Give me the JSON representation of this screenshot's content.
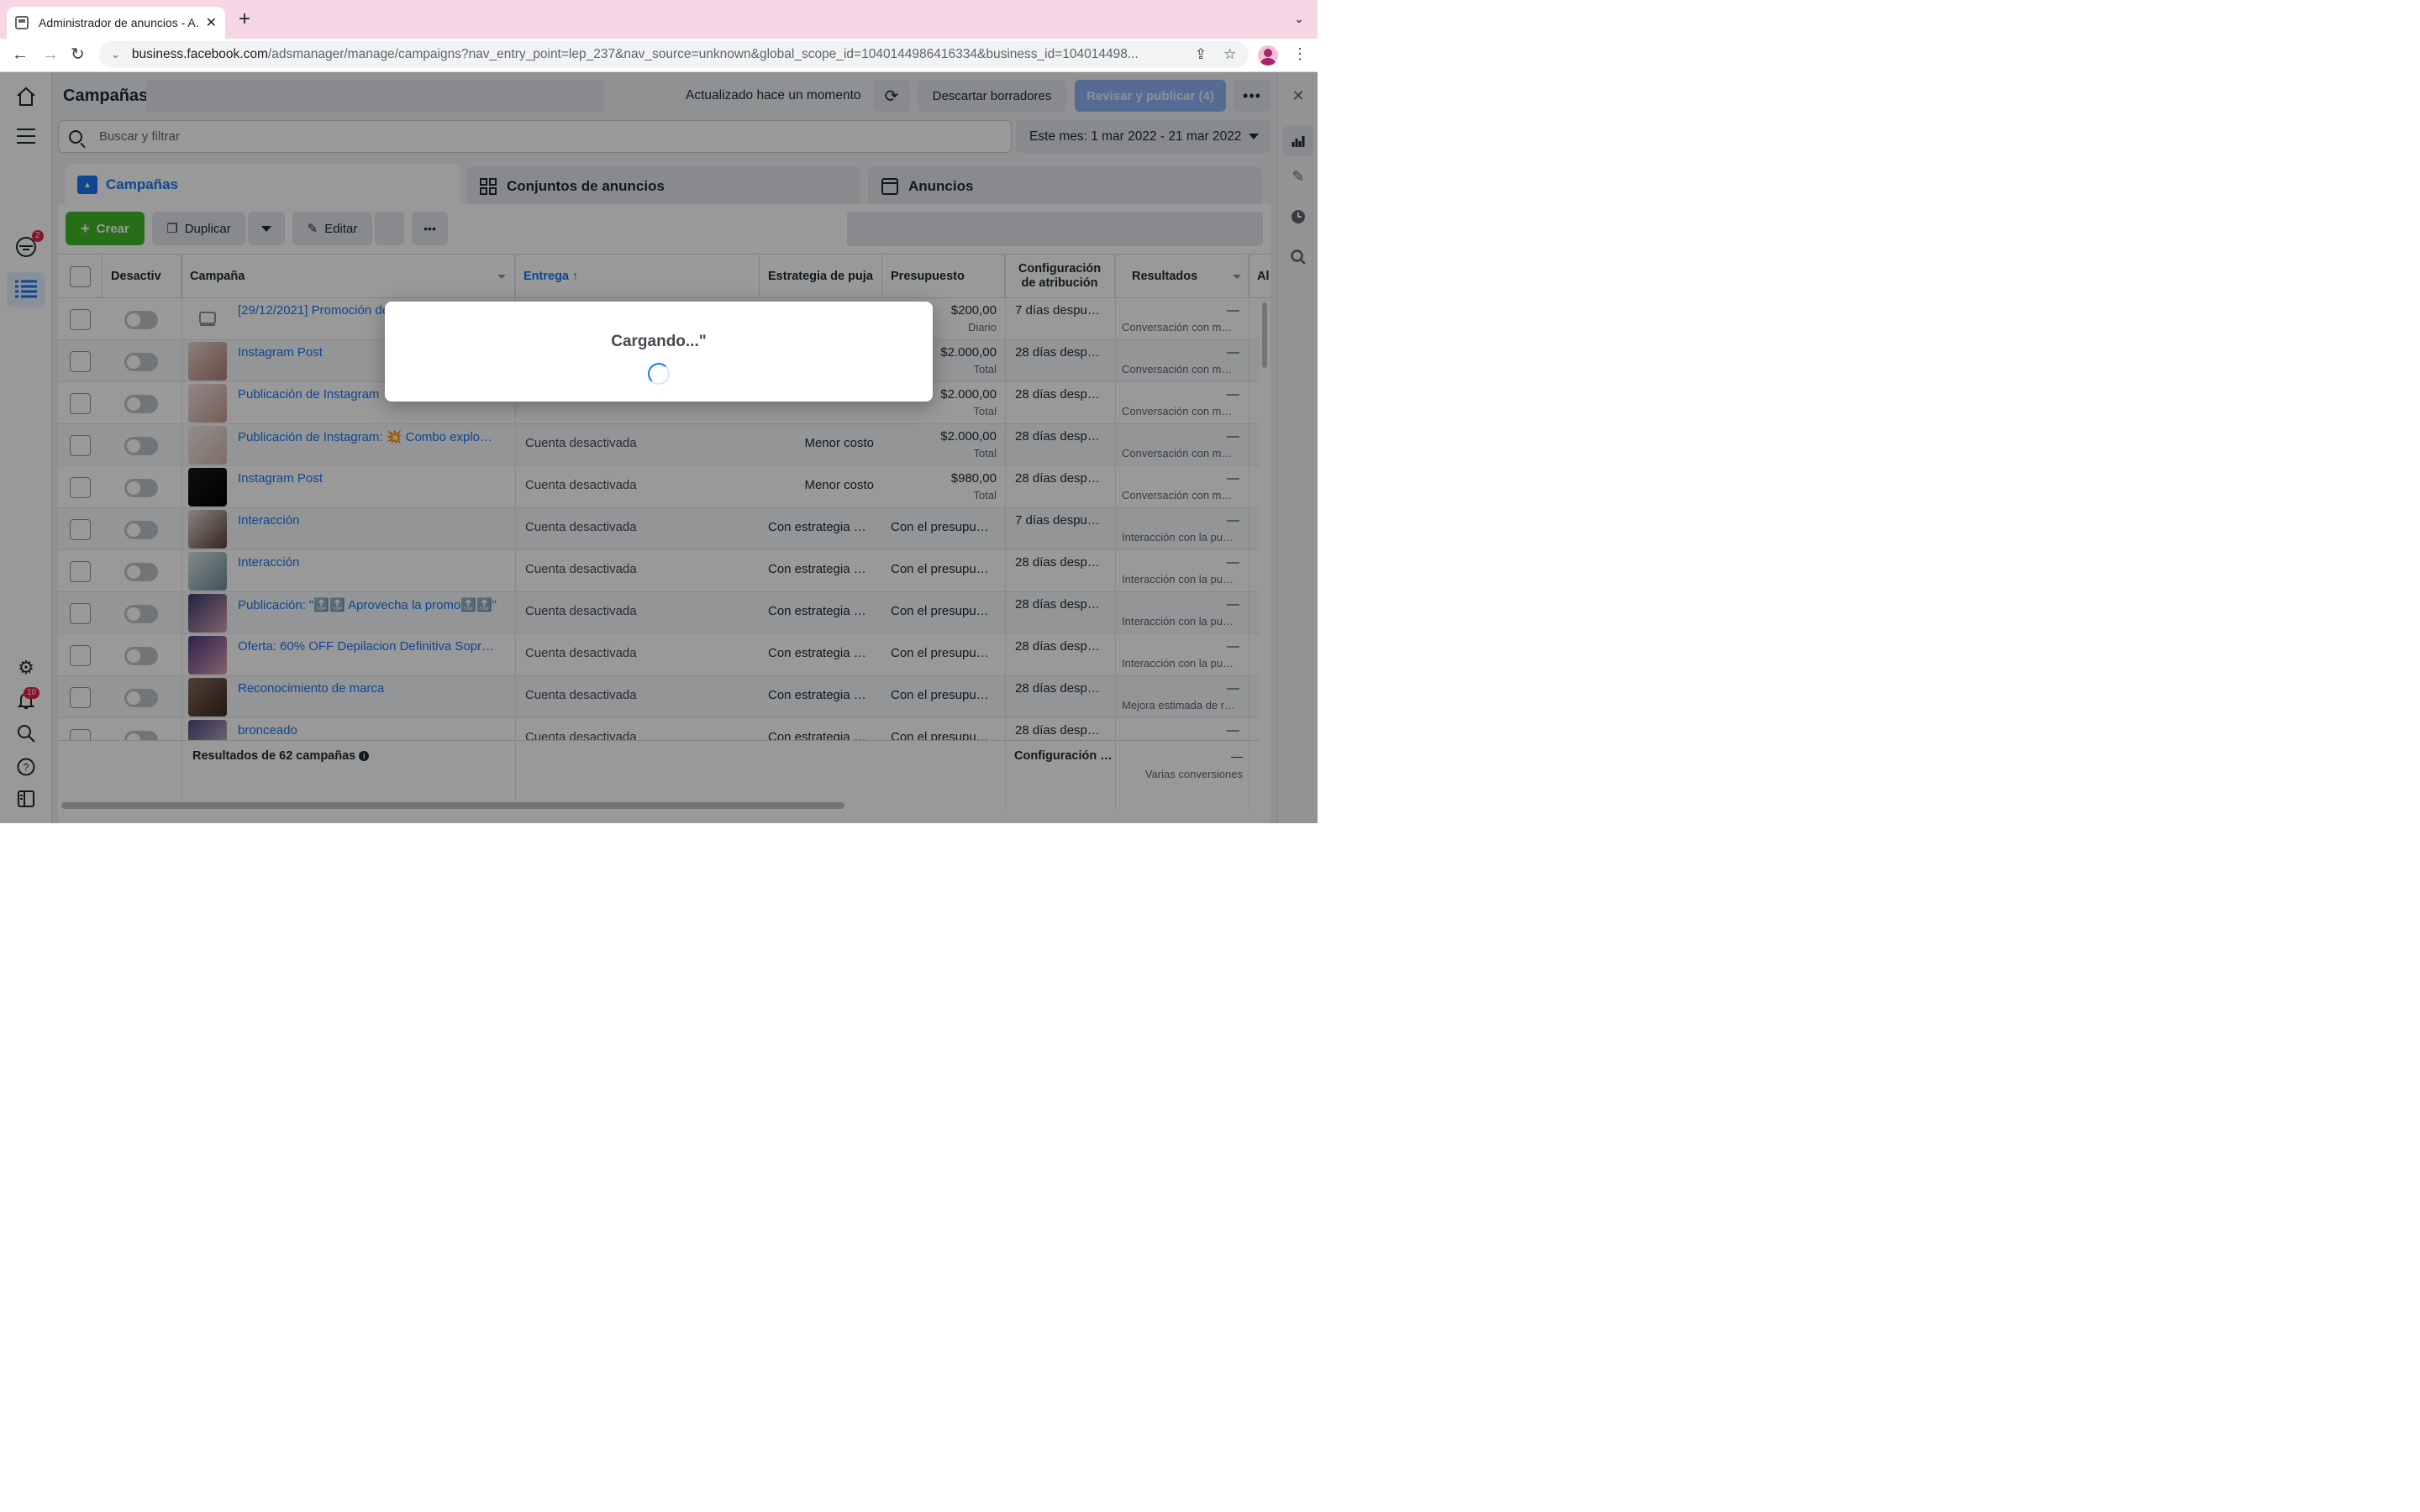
{
  "browser": {
    "tab_title": "Administrador de anuncios - A…",
    "new_tab": "+",
    "url_main": "business.facebook.com",
    "url_rest": "/adsmanager/manage/campaigns?nav_entry_point=lep_237&nav_source=unknown&global_scope_id=1040144986416334&business_id=104014498..."
  },
  "left_nav": {
    "campaigns_badge": "2",
    "notifications_badge": "10"
  },
  "header": {
    "title": "Campañas",
    "updated": "Actualizado hace un momento",
    "discard_label": "Descartar borradores",
    "publish_label": "Revisar y publicar (4)",
    "search_placeholder": "Buscar y filtrar",
    "date_range": "Este mes: 1 mar 2022 - 21 mar 2022"
  },
  "level_tabs": [
    {
      "label": "Campañas"
    },
    {
      "label": "Conjuntos de anuncios"
    },
    {
      "label": "Anuncios"
    }
  ],
  "toolbar": {
    "create": "Crear",
    "duplicate": "Duplicar",
    "edit": "Editar"
  },
  "columns": {
    "toggle": "Desactiv",
    "campaign": "Campaña",
    "delivery": "Entrega",
    "bid": "Estrategia de puja",
    "budget": "Presupuesto",
    "attribution_1": "Configuración",
    "attribution_2": "de atribución",
    "results": "Resultados",
    "next": "Al"
  },
  "rows": [
    {
      "name": "[29/12/2021] Promoción de",
      "delivery": "",
      "bid": "",
      "budget": "$200,00",
      "budget_sub": "Diario",
      "attribution": "7 días despu…",
      "result": "—",
      "result_sub": "Conversación con m…"
    },
    {
      "name": "Instagram Post",
      "delivery": "",
      "bid": "",
      "budget": "$2.000,00",
      "budget_sub": "Total",
      "attribution": "28 días desp…",
      "result": "—",
      "result_sub": "Conversación con m…"
    },
    {
      "name": "Publicación de Instagram",
      "delivery": "",
      "bid": "",
      "budget": "$2.000,00",
      "budget_sub": "Total",
      "attribution": "28 días desp…",
      "result": "—",
      "result_sub": "Conversación con m…"
    },
    {
      "name": "Publicación de Instagram: 💥 Combo explosi…",
      "delivery": "Cuenta desactivada",
      "bid": "Menor costo",
      "budget": "$2.000,00",
      "budget_sub": "Total",
      "attribution": "28 días desp…",
      "result": "—",
      "result_sub": "Conversación con m…"
    },
    {
      "name": "Instagram Post",
      "delivery": "Cuenta desactivada",
      "bid": "Menor costo",
      "budget": "$980,00",
      "budget_sub": "Total",
      "attribution": "28 días desp…",
      "result": "—",
      "result_sub": "Conversación con m…"
    },
    {
      "name": "Interacción",
      "delivery": "Cuenta desactivada",
      "bid": "Con estrategia …",
      "budget": "Con el presupu…",
      "budget_sub": "",
      "attribution": "7 días despu…",
      "result": "—",
      "result_sub": "Interacción con la pu…"
    },
    {
      "name": "Interacción",
      "delivery": "Cuenta desactivada",
      "bid": "Con estrategia …",
      "budget": "Con el presupu…",
      "budget_sub": "",
      "attribution": "28 días desp…",
      "result": "—",
      "result_sub": "Interacción con la pu…"
    },
    {
      "name": "Publicación: \"🔝🔝 Aprovecha la promo🔝🔝\"",
      "delivery": "Cuenta desactivada",
      "bid": "Con estrategia …",
      "budget": "Con el presupu…",
      "budget_sub": "",
      "attribution": "28 días desp…",
      "result": "—",
      "result_sub": "Interacción con la pu…"
    },
    {
      "name": "Oferta: 60% OFF Depilacion Definitiva Sopra…",
      "delivery": "Cuenta desactivada",
      "bid": "Con estrategia …",
      "budget": "Con el presupu…",
      "budget_sub": "",
      "attribution": "28 días desp…",
      "result": "—",
      "result_sub": "Interacción con la pu…"
    },
    {
      "name": "Reconocimiento de marca",
      "delivery": "Cuenta desactivada",
      "bid": "Con estrategia …",
      "budget": "Con el presupu…",
      "budget_sub": "",
      "attribution": "28 días desp…",
      "result": "—",
      "result_sub": "Mejora estimada de r…"
    },
    {
      "name": "bronceado",
      "delivery": "Cuenta desactivada",
      "bid": "Con estrategia …",
      "budget": "Con el presupu…",
      "budget_sub": "",
      "attribution": "28 días desp…",
      "result": "—",
      "result_sub": ""
    }
  ],
  "footer": {
    "summary": "Resultados de 62 campañas",
    "attribution": "Configuración …",
    "result": "—",
    "result_sub": "Varias conversiones"
  },
  "modal": {
    "text": "Cargando...\""
  },
  "colors": {
    "accent": "#1876f2",
    "create": "#42b72a",
    "chrome_tab_strip": "#f6d5e4"
  }
}
